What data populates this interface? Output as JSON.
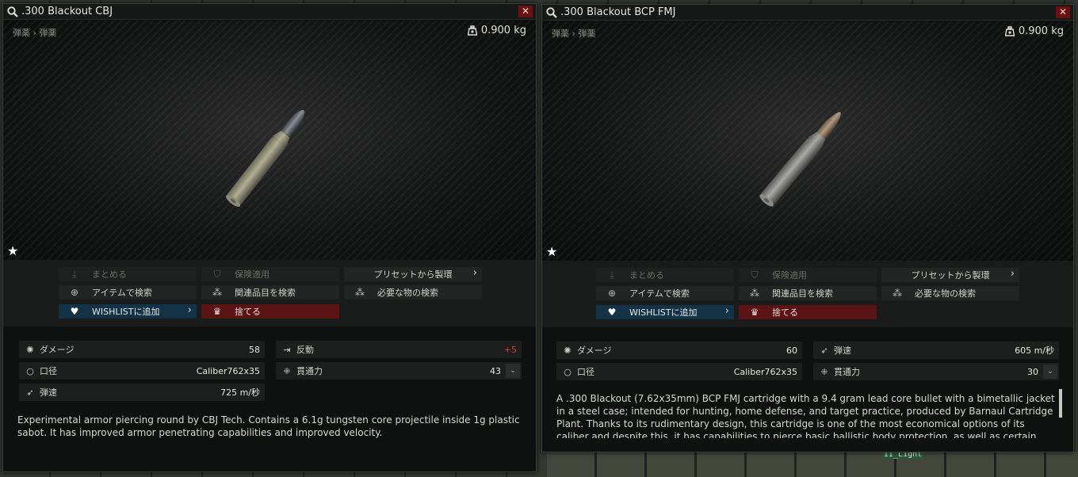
{
  "windows": [
    {
      "title": ".300 Blackout CBJ",
      "breadcrumb": "弾薬 › 弾薬",
      "weight": "0.900 kg",
      "actions": {
        "collapse": "まとめる",
        "insure": "保険適用",
        "preset": "プリセットから製環",
        "search_item": "アイテムで検索",
        "search_related": "関連品目を検索",
        "search_required": "必要な物の検索",
        "wishlist": "WISHLISTに追加",
        "discard": "捨てる"
      },
      "stats": {
        "damage_label": "ダメージ",
        "damage_value": "58",
        "recoil_label": "反動",
        "recoil_value": "+5",
        "caliber_label": "口径",
        "caliber_value": "Caliber762x35",
        "penetration_label": "貫通力",
        "penetration_value": "43",
        "velocity_label": "弾速",
        "velocity_value": "725 m/秒"
      },
      "description": "Experimental armor piercing round by CBJ Tech. Contains a 6.1g tungsten core projectile inside 1g plastic sabot. It has improved armor penetrating capabilities and improved velocity."
    },
    {
      "title": ".300 Blackout BCP FMJ",
      "breadcrumb": "弾薬 › 弾薬",
      "weight": "0.900 kg",
      "actions": {
        "collapse": "まとめる",
        "insure": "保険適用",
        "preset": "プリセットから製環",
        "search_item": "アイテムで検索",
        "search_related": "関連品目を検索",
        "search_required": "必要な物の検索",
        "wishlist": "WISHLISTに追加",
        "discard": "捨てる"
      },
      "stats": {
        "damage_label": "ダメージ",
        "damage_value": "60",
        "velocity_label": "弾速",
        "velocity_value": "605 m/秒",
        "caliber_label": "口径",
        "caliber_value": "Caliber762x35",
        "penetration_label": "貫通力",
        "penetration_value": "30"
      },
      "description": "A .300 Blackout (7.62x35mm) BCP FMJ cartridge with a 9.4 gram lead core bullet with a bimetallic jacket in a steel case; intended for hunting, home defense, and target practice, produced by Barnaul Cartridge Plant. Thanks to its rudimentary design, this cartridge is one of the most economical options of its caliber and despite this, it has capabilities to pierce basic ballistic body protection, as well as certain"
    }
  ],
  "background": {
    "tag": "II_Light"
  },
  "colors": {
    "wishlist": "#143346",
    "discard": "#5a1414",
    "negative": "#d33c2c"
  }
}
